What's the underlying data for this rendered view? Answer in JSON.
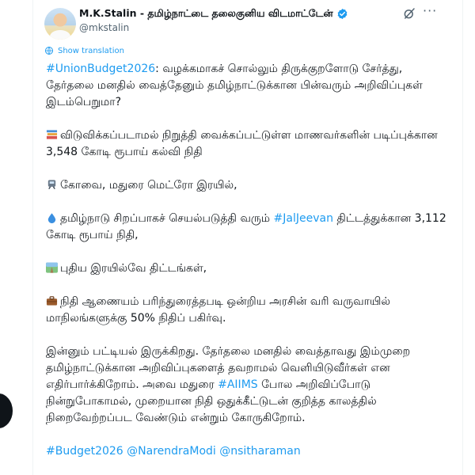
{
  "author": {
    "name": "M.K.Stalin - தமிழ்நாட்டை தலைகுனிய விடமாட்டேன்",
    "handle": "@mkstalin"
  },
  "icons": {
    "verified": "verified-badge-icon",
    "grok": "grok-icon",
    "more": "more-options-icon",
    "translate": "globe-icon"
  },
  "colors": {
    "link": "#1d9bf0",
    "text": "#0f1419",
    "muted": "#536471"
  },
  "more_label": "···",
  "translate_label": "Show translation",
  "tweet": {
    "p1_tag": "#UnionBudget2026",
    "p1_text": ": வழக்கமாகச் சொல்லும் திருக்குறளோடு சேர்த்து, தேர்தலை மனதில் வைத்தேனும் தமிழ்நாட்டுக்கான பின்வரும் அறிவிப்புகள் இடம்பெறுமா?",
    "p2_text": "விடுவிக்கப்படாமல் நிறுத்தி வைக்கப்பட்டுள்ள மாணவர்களின் படிப்புக்கான 3,548 கோடி ரூபாய் கல்வி நிதி",
    "p3_text": "கோவை, மதுரை மெட்ரோ இரயில்,",
    "p4_text_a": "தமிழ்நாடு சிறப்பாகச் செயல்படுத்தி வரும் ",
    "p4_tag": "#JalJeevan",
    "p4_text_b": " திட்டத்துக்கான 3,112 கோடி ரூபாய் நிதி,",
    "p5_text": "புதிய இரயில்வே திட்டங்கள்,",
    "p6_text": "நிதி ஆணையம் பரிந்துரைத்தபடி ஒன்றிய அரசின் வரி வருவாயில் மாநிலங்களுக்கு 50% நிதிப் பகிர்வு.",
    "p7_text_a": "இன்னும் பட்டியல் இருக்கிறது. தேர்தலை மனதில் வைத்தாவது இம்முறை தமிழ்நாட்டுக்கான அறிவிப்புகளைத் தவறாமல் வெளியிடுவீர்கள் என எதிர்பார்க்கிறோம். அவை மதுரை ",
    "p7_tag": "#AIIMS",
    "p7_text_b": " போல அறிவிப்போடு நின்றுபோகாமல், முறையான நிதி ஒதுக்கீட்டுடன் குறித்த காலத்தில் நிறைவேற்றப்பட வேண்டும் என்றும் கோருகிறோம்.",
    "p8_tag1": "#Budget2026",
    "p8_tag2": "@NarendraModi",
    "p8_tag3": "@nsitharaman"
  },
  "emoji_icons": [
    "books-emoji",
    "metro-emoji",
    "droplet-emoji",
    "railway-emoji",
    "briefcase-emoji"
  ]
}
